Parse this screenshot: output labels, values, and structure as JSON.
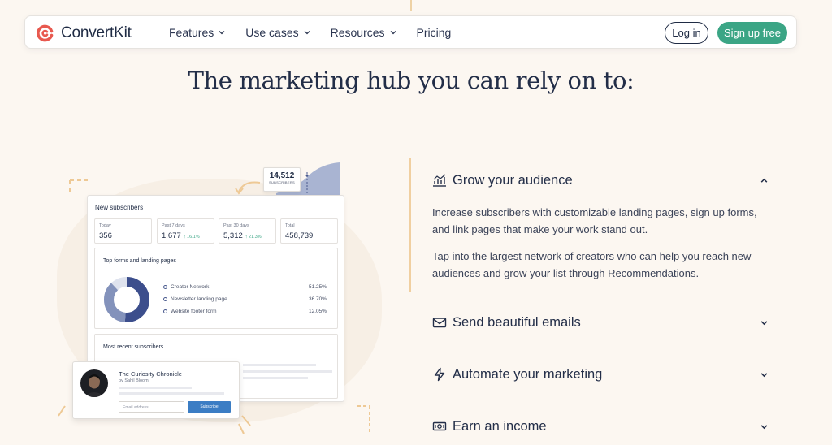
{
  "brand": {
    "name": "ConvertKit",
    "accent": "#e8594f",
    "green": "#3ba585"
  },
  "nav": {
    "links": [
      {
        "label": "Features",
        "dropdown": true
      },
      {
        "label": "Use cases",
        "dropdown": true
      },
      {
        "label": "Resources",
        "dropdown": true
      },
      {
        "label": "Pricing",
        "dropdown": false
      }
    ],
    "login_label": "Log in",
    "signup_label": "Sign up free"
  },
  "headline": "The marketing hub you can rely on to:",
  "dashboard": {
    "title": "New subscribers",
    "stats": [
      {
        "label": "Today",
        "value": "356",
        "delta": ""
      },
      {
        "label": "Past 7 days",
        "value": "1,677",
        "delta": "↑ 16.1%"
      },
      {
        "label": "Past 30 days",
        "value": "5,312",
        "delta": "↑ 21.3%"
      },
      {
        "label": "Total",
        "value": "458,739",
        "delta": ""
      }
    ],
    "forms_title": "Top forms and landing pages",
    "forms": [
      {
        "name": "Creator Network",
        "pct": "51.25%"
      },
      {
        "name": "Newsletter landing page",
        "pct": "36.70%"
      },
      {
        "name": "Website footer form",
        "pct": "12.05%"
      }
    ],
    "recent_title": "Most recent subscribers",
    "bubble_value": "14,512",
    "bubble_label": "SUBSCRIBERS"
  },
  "creator": {
    "title": "The Curiosity Chronicle",
    "author": "by Sahil Bloom",
    "email_placeholder": "Email address",
    "subscribe_label": "Subscribe"
  },
  "accordion": [
    {
      "label": "Grow your audience",
      "icon": "chart-icon",
      "expanded": true,
      "paragraphs": [
        "Increase subscribers with customizable landing pages, sign up forms, and link pages that make your work stand out.",
        "Tap into the largest network of creators who can help you reach new audiences and grow your list through Recommendations."
      ]
    },
    {
      "label": "Send beautiful emails",
      "icon": "envelope-icon",
      "expanded": false
    },
    {
      "label": "Automate your marketing",
      "icon": "lightning-icon",
      "expanded": false
    },
    {
      "label": "Earn an income",
      "icon": "money-icon",
      "expanded": false
    }
  ]
}
